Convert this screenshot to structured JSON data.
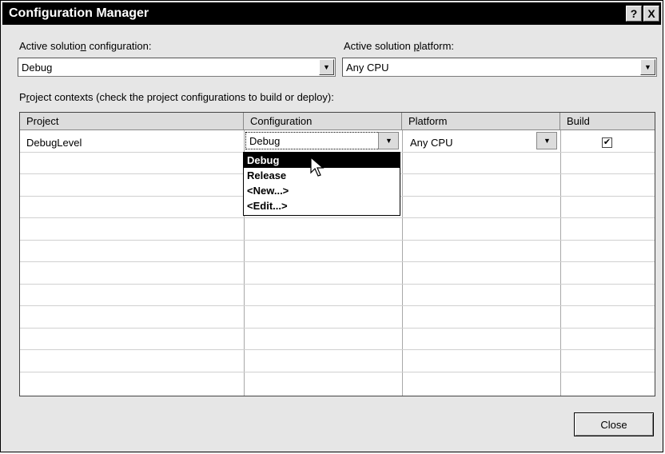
{
  "window": {
    "title": "Configuration Manager",
    "help_label": "?",
    "close_label": "X"
  },
  "solution": {
    "config_label": "Active solution configuration:",
    "config_value": "Debug",
    "platform_label": "Active solution platform:",
    "platform_value": "Any CPU"
  },
  "contexts_label": "Project contexts (check the project configurations to build or deploy):",
  "grid": {
    "headers": [
      "Project",
      "Configuration",
      "Platform",
      "Build"
    ],
    "rows": [
      {
        "project": "DebugLevel",
        "configuration": "Debug",
        "platform": "Any CPU",
        "build": true
      }
    ]
  },
  "config_dropdown": {
    "options": [
      "Debug",
      "Release",
      "<New...>",
      "<Edit...>"
    ],
    "selected": "Debug"
  },
  "buttons": {
    "close": "Close"
  }
}
